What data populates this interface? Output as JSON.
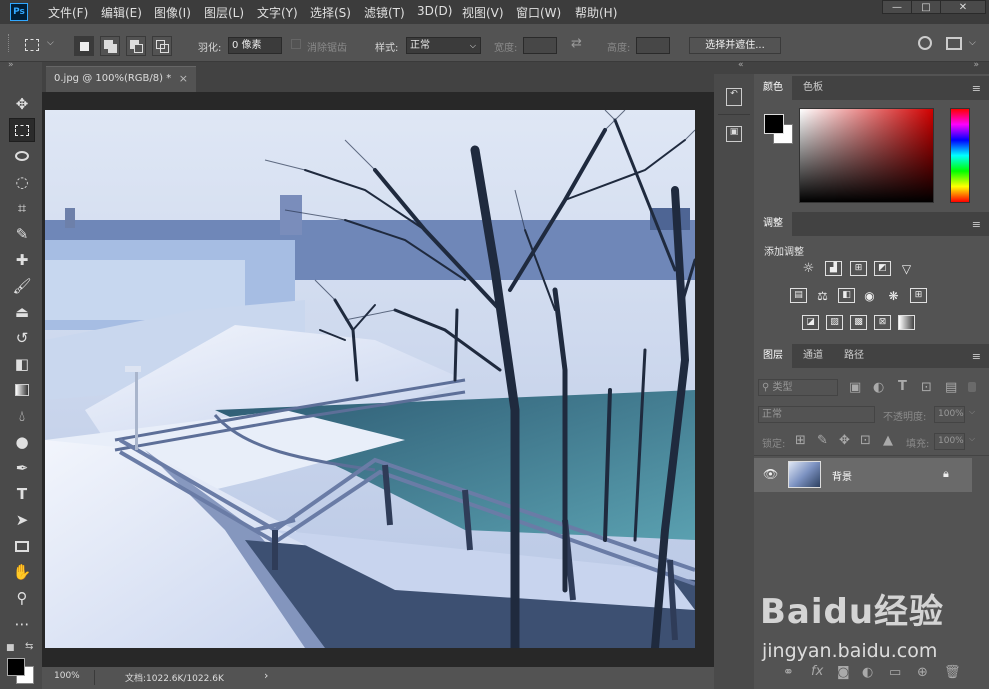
{
  "menubar": {
    "logo": "Ps",
    "items": [
      "文件(F)",
      "编辑(E)",
      "图像(I)",
      "图层(L)",
      "文字(Y)",
      "选择(S)",
      "滤镜(T)",
      "3D(D)",
      "视图(V)",
      "窗口(W)",
      "帮助(H)"
    ],
    "window_buttons": {
      "minimize": "—",
      "maximize": "□",
      "close": "✕"
    }
  },
  "options_bar": {
    "feather_label": "羽化:",
    "feather_value": "0 像素",
    "antialias_label": "消除锯齿",
    "style_label": "样式:",
    "style_value": "正常",
    "width_label": "宽度:",
    "height_label": "高度:",
    "select_mask_button": "选择并遮住..."
  },
  "document": {
    "tab_title": "0.jpg @ 100%(RGB/8) *",
    "close": "×"
  },
  "status_bar": {
    "zoom": "100%",
    "doc_info": "文档:1022.6K/1022.6K",
    "arrow": "›"
  },
  "color_panel": {
    "tabs": [
      "颜色",
      "色板"
    ],
    "foreground": "#000000",
    "background": "#ffffff"
  },
  "adjustments_panel": {
    "tab": "调整",
    "add_label": "添加调整"
  },
  "layers_panel": {
    "tabs": [
      "图层",
      "通道",
      "路径"
    ],
    "filter_kind": "类型",
    "blend_mode": "正常",
    "opacity_label": "不透明度:",
    "opacity_value": "100%",
    "lock_label": "锁定:",
    "fill_label": "填充:",
    "fill_value": "100%",
    "layers": [
      {
        "name": "背景",
        "visible": true,
        "locked": true
      }
    ]
  },
  "watermark": {
    "brand_text": "Baidu经验",
    "url": "jingyan.baidu.com"
  },
  "colors": {
    "ui_dark": "#3c3c3c",
    "ui_mid": "#535353",
    "ui_panel_tabs": "#424242",
    "canvas_bg": "#282828",
    "accent_blue": "#31a8ff"
  }
}
